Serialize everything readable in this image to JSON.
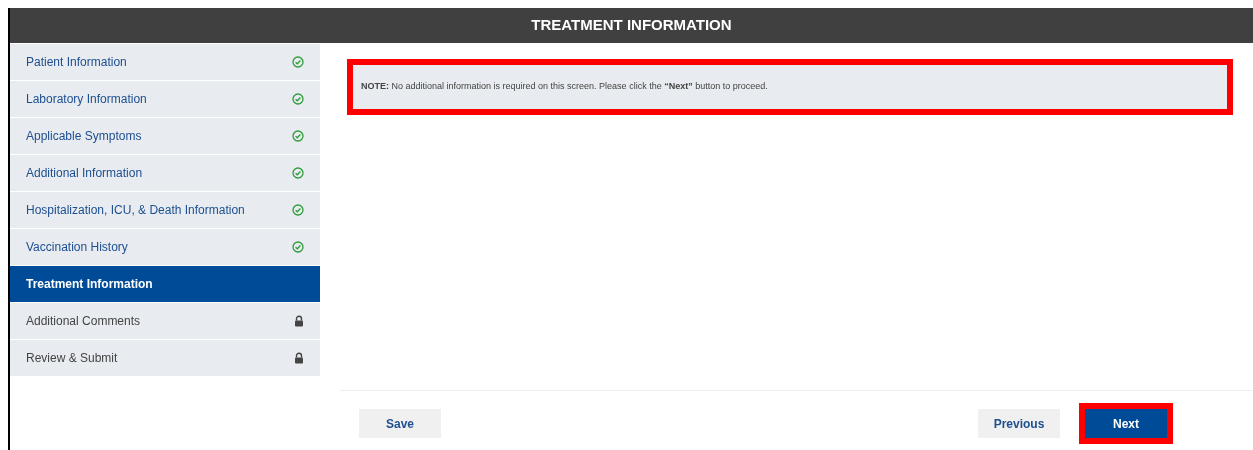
{
  "header": {
    "title": "TREATMENT INFORMATION"
  },
  "sidebar": {
    "items": [
      {
        "label": "Patient Information",
        "kind": "complete",
        "selected": false
      },
      {
        "label": "Laboratory Information",
        "kind": "complete",
        "selected": false
      },
      {
        "label": "Applicable Symptoms",
        "kind": "complete",
        "selected": false
      },
      {
        "label": "Additional Information",
        "kind": "complete",
        "selected": false
      },
      {
        "label": "Hospitalization, ICU, & Death Information",
        "kind": "complete",
        "selected": false
      },
      {
        "label": "Vaccination History",
        "kind": "complete",
        "selected": false
      },
      {
        "label": "Treatment Information",
        "kind": "current",
        "selected": true
      },
      {
        "label": "Additional Comments",
        "kind": "locked",
        "selected": false
      },
      {
        "label": "Review & Submit",
        "kind": "locked",
        "selected": false
      }
    ]
  },
  "note": {
    "text": "**NOTE:** No additional information is required on this screen. Please click the **“Next”** button to proceed.",
    "highlighted": true
  },
  "buttons": [
    {
      "label": "Save",
      "kind": "secondary",
      "highlighted": false
    },
    {
      "label": "Previous",
      "kind": "secondary",
      "highlighted": false
    },
    {
      "label": "Next",
      "kind": "primary",
      "highlighted": true
    }
  ]
}
